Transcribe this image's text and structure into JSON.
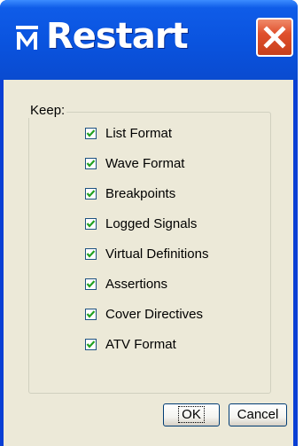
{
  "window": {
    "title": "Restart",
    "app_icon": "m-logo-icon"
  },
  "title_buttons": {
    "close_icon": "close-icon"
  },
  "group": {
    "label": "Keep:",
    "options": [
      {
        "label": "List Format",
        "checked": true
      },
      {
        "label": "Wave Format",
        "checked": true
      },
      {
        "label": "Breakpoints",
        "checked": true
      },
      {
        "label": "Logged Signals",
        "checked": true
      },
      {
        "label": "Virtual Definitions",
        "checked": true
      },
      {
        "label": "Assertions",
        "checked": true
      },
      {
        "label": "Cover Directives",
        "checked": true
      },
      {
        "label": "ATV Format",
        "checked": true
      }
    ]
  },
  "buttons": {
    "ok": "OK",
    "cancel": "Cancel"
  },
  "colors": {
    "titlebar": "#0a53de",
    "client_bg": "#ece9d8",
    "close_button": "#e0502c",
    "check": "#21a121"
  }
}
